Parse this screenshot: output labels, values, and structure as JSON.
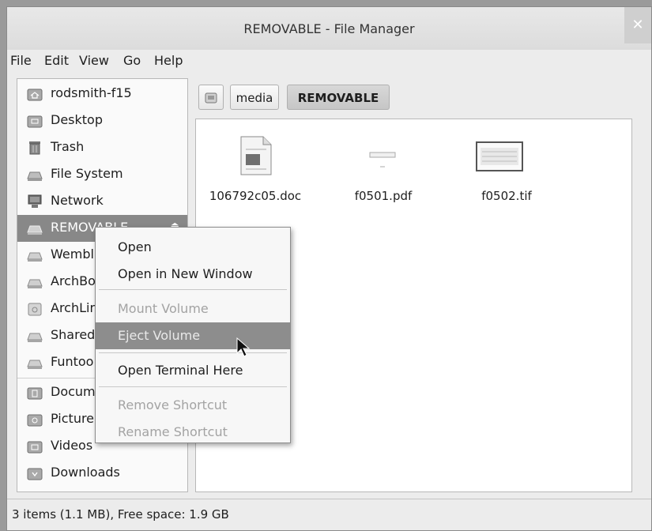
{
  "window": {
    "title": "REMOVABLE - File Manager",
    "close_icon": "close-icon"
  },
  "menubar": [
    "File",
    "Edit",
    "View",
    "Go",
    "Help"
  ],
  "sidebar": {
    "items": [
      {
        "label": "rodsmith-f15",
        "icon": "home-folder-icon"
      },
      {
        "label": "Desktop",
        "icon": "desktop-folder-icon"
      },
      {
        "label": "Trash",
        "icon": "trash-icon"
      },
      {
        "label": "File System",
        "icon": "drive-icon"
      },
      {
        "label": "Network",
        "icon": "network-icon"
      },
      {
        "label": "REMOVABLE",
        "icon": "drive-icon",
        "selected": true,
        "eject_icon": "eject-icon"
      },
      {
        "label": "Wembl",
        "icon": "drive-icon"
      },
      {
        "label": "ArchBo",
        "icon": "drive-icon"
      },
      {
        "label": "ArchLin",
        "icon": "drive-icon"
      },
      {
        "label": "Shared",
        "icon": "drive-icon"
      },
      {
        "label": "Funtoo",
        "icon": "drive-icon"
      },
      {
        "label": "Docume",
        "icon": "documents-folder-icon"
      },
      {
        "label": "Picture",
        "icon": "pictures-folder-icon"
      },
      {
        "label": "Videos",
        "icon": "videos-folder-icon"
      },
      {
        "label": "Downloads",
        "icon": "downloads-folder-icon"
      }
    ]
  },
  "pathbar": {
    "segments": [
      "media",
      "REMOVABLE"
    ],
    "active": "REMOVABLE"
  },
  "files": [
    {
      "name": "106792c05.doc",
      "icon": "document-file-icon"
    },
    {
      "name": "f0501.pdf",
      "icon": "pdf-file-icon"
    },
    {
      "name": "f0502.tif",
      "icon": "image-file-icon"
    }
  ],
  "context_menu": {
    "items": [
      {
        "label": "Open",
        "enabled": true
      },
      {
        "label": "Open in New Window",
        "enabled": true
      },
      {
        "label": "Mount Volume",
        "enabled": false
      },
      {
        "label": "Eject Volume",
        "enabled": false,
        "highlighted": true
      },
      {
        "label": "Open Terminal Here",
        "enabled": true
      },
      {
        "label": "Remove Shortcut",
        "enabled": false
      },
      {
        "label": "Rename Shortcut",
        "enabled": false
      }
    ]
  },
  "statusbar": {
    "text": "3 items (1.1 MB), Free space: 1.9 GB"
  }
}
